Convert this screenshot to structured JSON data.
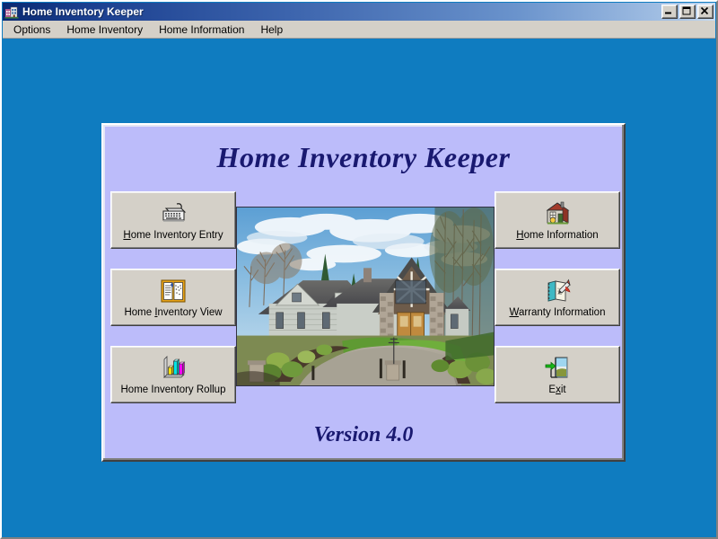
{
  "window": {
    "title": "Home Inventory Keeper",
    "title_icon": "house-icon",
    "controls": {
      "minimize": "minimize-icon",
      "maximize": "maximize-icon",
      "close": "close-icon"
    }
  },
  "menu": {
    "items": [
      {
        "label": "Options"
      },
      {
        "label": "Home Inventory"
      },
      {
        "label": "Home Information"
      },
      {
        "label": "Help"
      }
    ]
  },
  "panel": {
    "title": "Home Inventory Keeper",
    "version": "Version 4.0",
    "photo_alt": "Large craftsman style house with stone pillars, driveway and landscaped garden under blue sky",
    "buttons_left": [
      {
        "label_pre": "",
        "accel": "H",
        "label_post": "ome Inventory Entry",
        "icon": "keyboard-icon",
        "name": "home-inventory-entry-button"
      },
      {
        "label_pre": "Home ",
        "accel": "I",
        "label_post": "nventory View",
        "icon": "document-view-icon",
        "name": "home-inventory-view-button"
      },
      {
        "label_pre": "Home Inventory Rollup",
        "accel": "",
        "label_post": "",
        "icon": "bar-chart-icon",
        "name": "home-inventory-rollup-button"
      }
    ],
    "buttons_right": [
      {
        "label_pre": "",
        "accel": "H",
        "label_post": "ome Information",
        "icon": "house-building-icon",
        "name": "home-information-button"
      },
      {
        "label_pre": "",
        "accel": "W",
        "label_post": "arranty Information",
        "icon": "notepad-pen-icon",
        "name": "warranty-information-button"
      },
      {
        "label_pre": "E",
        "accel": "x",
        "label_post": "it",
        "icon": "exit-door-icon",
        "name": "exit-button"
      }
    ]
  },
  "colors": {
    "desktop": "#0f7cc0",
    "panel_bg": "#bcbcfa",
    "title_text": "#191970",
    "button_face": "#d4d0c8",
    "titlebar_start": "#0a2a72",
    "titlebar_end": "#c8dcf2"
  }
}
